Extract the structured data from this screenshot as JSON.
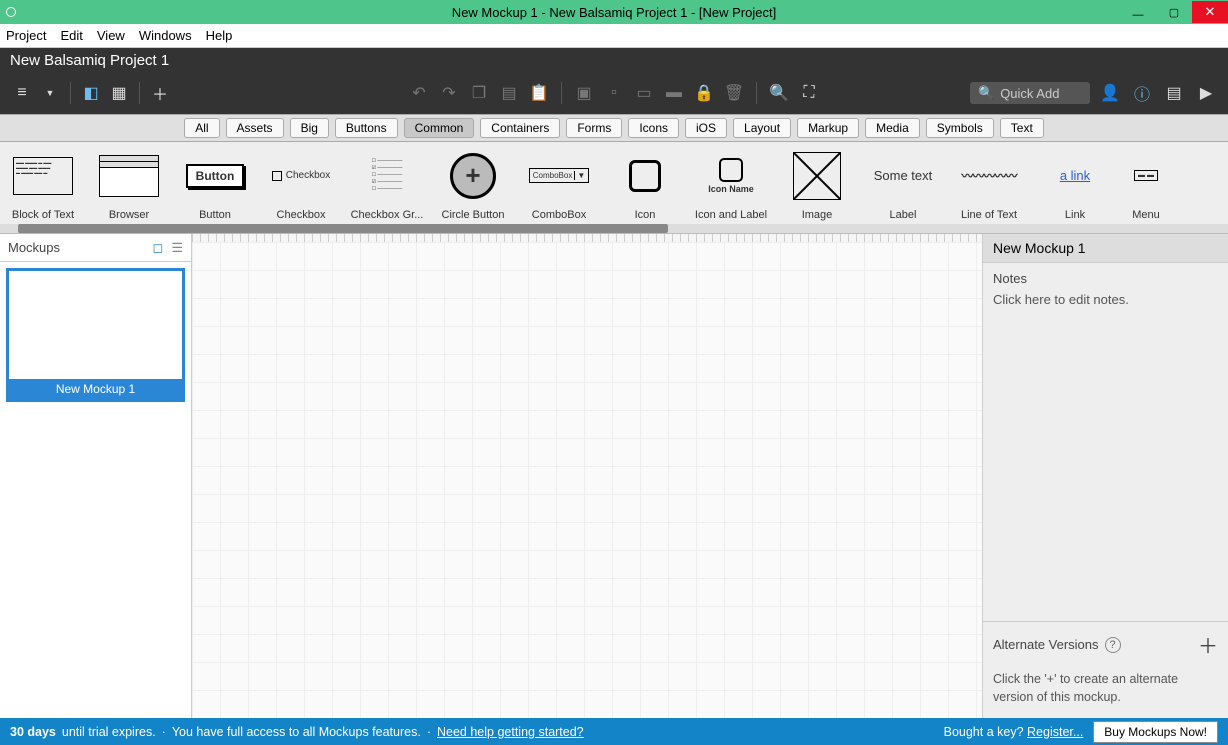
{
  "window": {
    "title": "New Mockup 1 - New Balsamiq Project 1 - [New Project]"
  },
  "menu": [
    "Project",
    "Edit",
    "View",
    "Windows",
    "Help"
  ],
  "project_name": "New Balsamiq Project 1",
  "quick_add_placeholder": "Quick Add",
  "categories": [
    "All",
    "Assets",
    "Big",
    "Buttons",
    "Common",
    "Containers",
    "Forms",
    "Icons",
    "iOS",
    "Layout",
    "Markup",
    "Media",
    "Symbols",
    "Text"
  ],
  "selected_category": "Common",
  "library": [
    {
      "label": "Block of Text"
    },
    {
      "label": "Browser"
    },
    {
      "label": "Button",
      "inner": "Button"
    },
    {
      "label": "Checkbox",
      "inner": "Checkbox"
    },
    {
      "label": "Checkbox Gr..."
    },
    {
      "label": "Circle Button",
      "inner": "+"
    },
    {
      "label": "ComboBox",
      "inner": "ComboBox"
    },
    {
      "label": "Icon"
    },
    {
      "label": "Icon and Label",
      "inner": "Icon Name"
    },
    {
      "label": "Image"
    },
    {
      "label": "Label",
      "inner": "Some text"
    },
    {
      "label": "Line of Text",
      "inner": "~~~~~~~"
    },
    {
      "label": "Link",
      "inner": "a link"
    },
    {
      "label": "Menu"
    }
  ],
  "left_panel": {
    "title": "Mockups",
    "thumb_name": "New Mockup 1"
  },
  "right_panel": {
    "title": "New Mockup 1",
    "notes_header": "Notes",
    "notes_text": "Click here to edit notes.",
    "alt_header": "Alternate Versions",
    "alt_text": "Click the '+' to create an alternate version of this mockup."
  },
  "trial": {
    "days": "30 days",
    "msg1": "until trial expires.",
    "msg2": "You have full access to all Mockups features.",
    "help_link": "Need help getting started?",
    "bought": "Bought a key?",
    "register": "Register...",
    "buy": "Buy Mockups Now!"
  }
}
